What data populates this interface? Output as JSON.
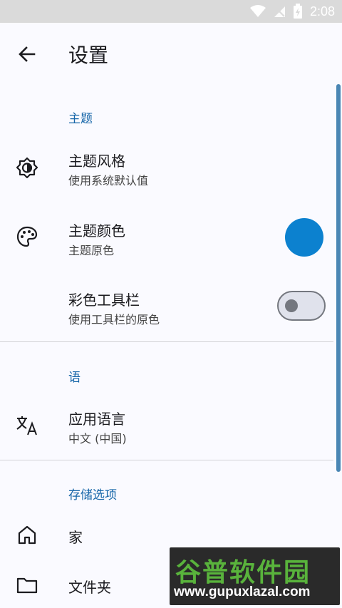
{
  "status_bar": {
    "time": "2:08"
  },
  "app_bar": {
    "title": "设置"
  },
  "sections": {
    "theme": "主题",
    "language": "语",
    "storage": "存储选项"
  },
  "rows": {
    "theme_style": {
      "title": "主题风格",
      "subtitle": "使用系统默认值",
      "icon": "brightness-icon"
    },
    "theme_color": {
      "title": "主题颜色",
      "subtitle": "主题原色",
      "icon": "palette-icon",
      "color": "#0c81cf"
    },
    "colored_toolbar": {
      "title": "彩色工具栏",
      "subtitle": "使用工具栏的原色",
      "enabled": false
    },
    "app_language": {
      "title": "应用语言",
      "subtitle": "中文 (中国)",
      "icon": "translate-icon"
    },
    "home": {
      "title": "家",
      "icon": "home-icon"
    },
    "folder": {
      "title": "文件夹",
      "icon": "folder-icon"
    }
  },
  "watermark": {
    "brand": "谷普软件园",
    "url": "www.gupuxlazal.com"
  },
  "colors": {
    "accent": "#1565a8",
    "background": "#fafaff"
  }
}
